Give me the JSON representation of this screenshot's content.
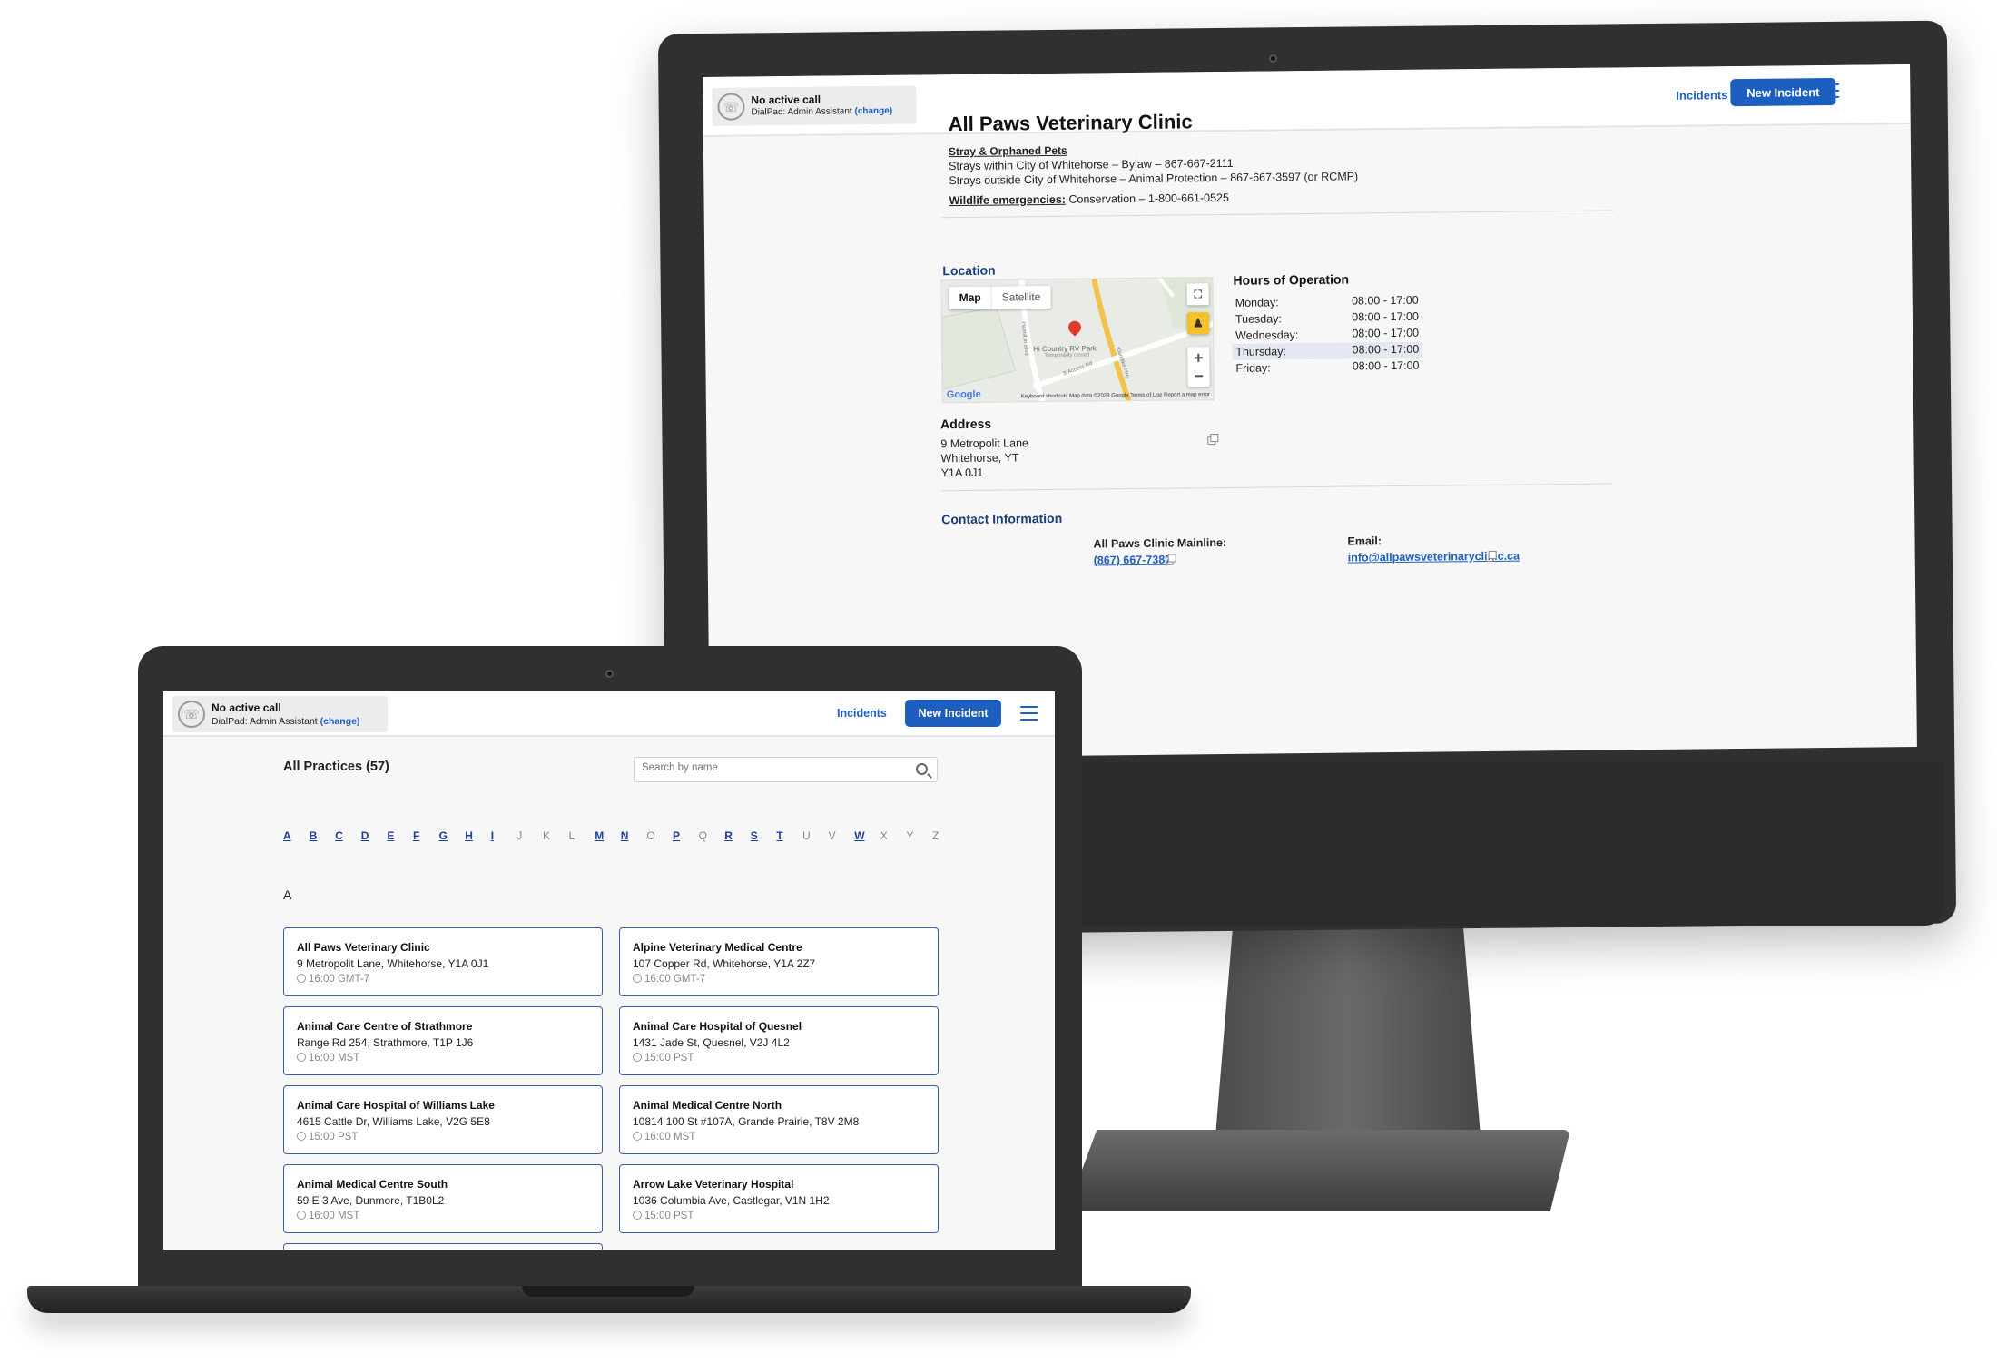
{
  "call": {
    "title": "No active call",
    "sub": "DialPad: Admin Assistant",
    "change": "(change)"
  },
  "header": {
    "incidents": "Incidents",
    "new_incident": "New Incident"
  },
  "clinic": {
    "name": "All Paws Veterinary Clinic",
    "stray_heading": "Stray & Orphaned Pets",
    "stray_line1": "Strays within City of Whitehorse – Bylaw – 867-667-2111",
    "stray_line2": "Strays outside City of Whitehorse – Animal Protection – 867-667-3597 (or RCMP)",
    "wildlife_label": "Wildlife emergencies:",
    "wildlife_value": "Conservation – 1-800-661-0525",
    "location_heading": "Location",
    "map": {
      "tab_map": "Map",
      "tab_satellite": "Satellite",
      "place": "Hi Country RV Park",
      "place_note": "Temporarily closed",
      "road1": "Klondike Hwy",
      "road2": "S Access Rd",
      "road3": "Hamilton Blvd",
      "logo": "Google",
      "footer": "Keyboard shortcuts   Map data ©2023 Google   Terms of Use   Report a map error"
    },
    "hours_heading": "Hours of Operation",
    "hours": [
      {
        "day": "Monday:",
        "time": "08:00 - 17:00"
      },
      {
        "day": "Tuesday:",
        "time": "08:00 - 17:00"
      },
      {
        "day": "Wednesday:",
        "time": "08:00 - 17:00"
      },
      {
        "day": "Thursday:",
        "time": "08:00 - 17:00"
      },
      {
        "day": "Friday:",
        "time": "08:00 - 17:00"
      }
    ],
    "address_heading": "Address",
    "address": [
      "9 Metropolit Lane",
      "Whitehorse, YT",
      "Y1A 0J1"
    ],
    "contact_heading": "Contact Information",
    "mainline_label": "All Paws Clinic Mainline:",
    "mainline_value": "(867) 667-7387",
    "email_label": "Email:",
    "email_value": "info@allpawsveterinaryclinic.ca"
  },
  "practices": {
    "title": "All Practices (57)",
    "search_placeholder": "Search by name",
    "alphabet": [
      {
        "l": "A",
        "on": true
      },
      {
        "l": "B",
        "on": true
      },
      {
        "l": "C",
        "on": true
      },
      {
        "l": "D",
        "on": true
      },
      {
        "l": "E",
        "on": true
      },
      {
        "l": "F",
        "on": true
      },
      {
        "l": "G",
        "on": true
      },
      {
        "l": "H",
        "on": true
      },
      {
        "l": "I",
        "on": true
      },
      {
        "l": "J",
        "on": false
      },
      {
        "l": "K",
        "on": false
      },
      {
        "l": "L",
        "on": false
      },
      {
        "l": "M",
        "on": true
      },
      {
        "l": "N",
        "on": true
      },
      {
        "l": "O",
        "on": false
      },
      {
        "l": "P",
        "on": true
      },
      {
        "l": "Q",
        "on": false
      },
      {
        "l": "R",
        "on": true
      },
      {
        "l": "S",
        "on": true
      },
      {
        "l": "T",
        "on": true
      },
      {
        "l": "U",
        "on": false
      },
      {
        "l": "V",
        "on": false
      },
      {
        "l": "W",
        "on": true
      },
      {
        "l": "X",
        "on": false
      },
      {
        "l": "Y",
        "on": false
      },
      {
        "l": "Z",
        "on": false
      }
    ],
    "group_letter": "A",
    "cards": [
      {
        "name": "All Paws Veterinary Clinic",
        "address": "9 Metropolit Lane, Whitehorse, Y1A 0J1",
        "time": "16:00 GMT-7"
      },
      {
        "name": "Alpine Veterinary Medical Centre",
        "address": "107 Copper Rd, Whitehorse, Y1A 2Z7",
        "time": "16:00 GMT-7"
      },
      {
        "name": "Animal Care Centre of Strathmore",
        "address": "Range Rd 254, Strathmore, T1P 1J6",
        "time": "16:00 MST"
      },
      {
        "name": "Animal Care Hospital of Quesnel",
        "address": "1431 Jade St, Quesnel, V2J 4L2",
        "time": "15:00 PST"
      },
      {
        "name": "Animal Care Hospital of Williams Lake",
        "address": "4615 Cattle Dr, Williams Lake, V2G 5E8",
        "time": "15:00 PST"
      },
      {
        "name": "Animal Medical Centre North",
        "address": "10814 100 St #107A, Grande Prairie, T8V 2M8",
        "time": "16:00 MST"
      },
      {
        "name": "Animal Medical Centre South",
        "address": "59 E 3 Ave, Dunmore, T1B0L2",
        "time": "16:00 MST"
      },
      {
        "name": "Arrow Lake Veterinary Hospital",
        "address": "1036 Columbia Ave, Castlegar, V1N 1H2",
        "time": "15:00 PST"
      }
    ]
  }
}
